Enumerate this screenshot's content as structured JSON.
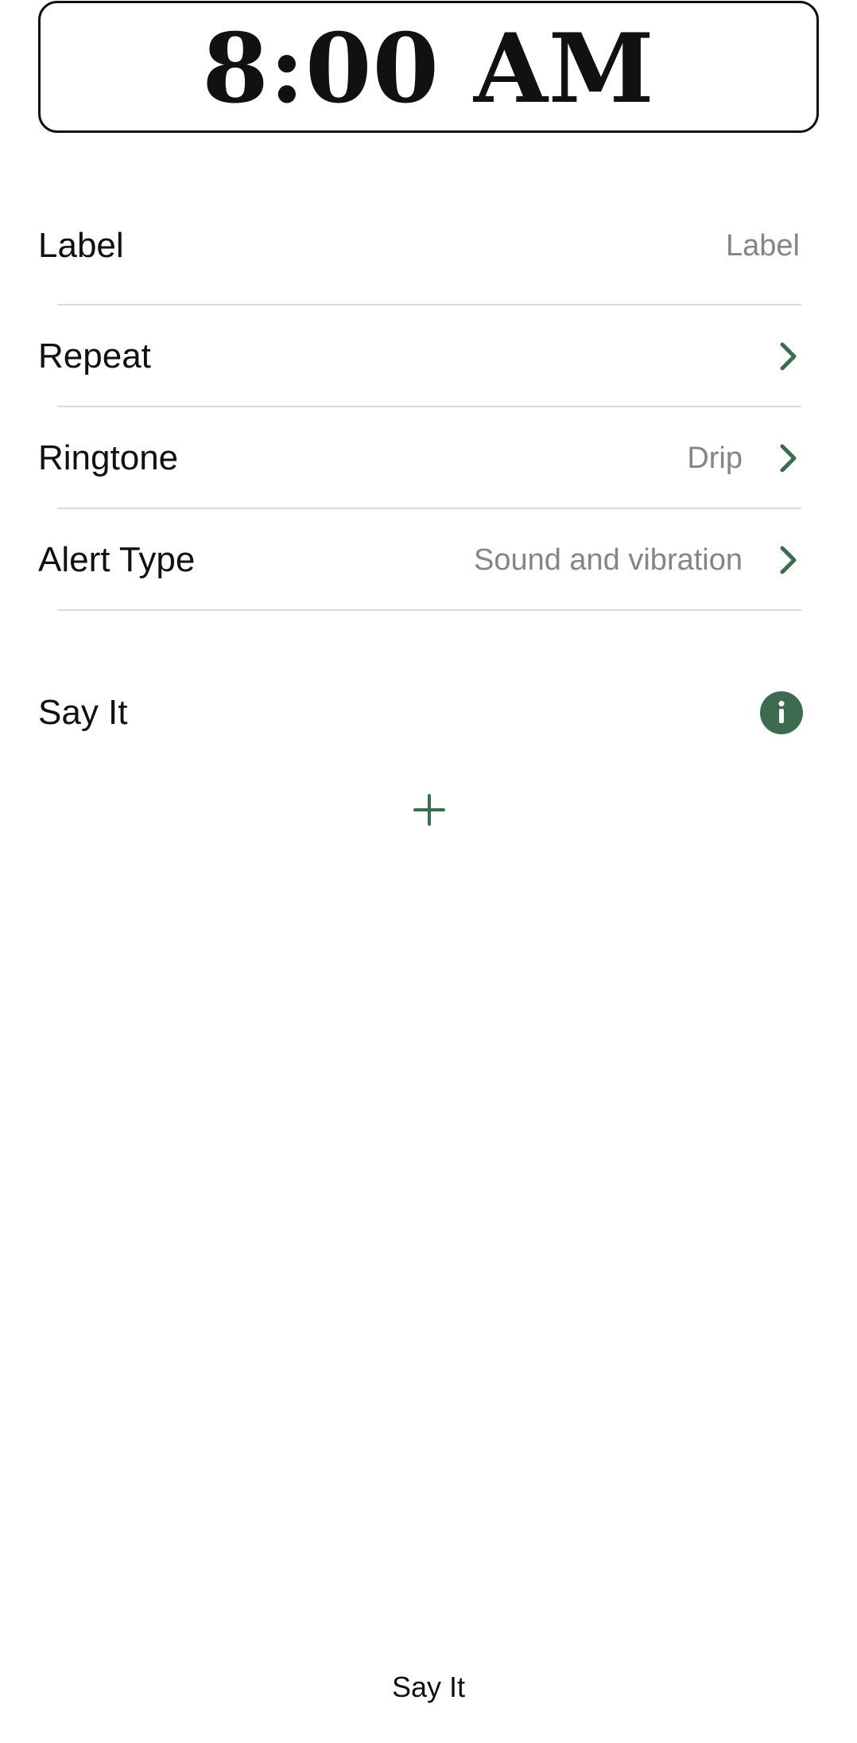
{
  "alarm": {
    "time": "8:00 AM"
  },
  "settings": {
    "label_row": {
      "title": "Label",
      "value": "Label"
    },
    "repeat_row": {
      "title": "Repeat"
    },
    "ringtone_row": {
      "title": "Ringtone",
      "value": "Drip"
    },
    "alert_type_row": {
      "title": "Alert Type",
      "value": "Sound and vibration"
    }
  },
  "say_it": {
    "title": "Say It",
    "info_icon": "info-icon",
    "add_icon": "plus-icon"
  },
  "bottom_bar": {
    "label": "Say It"
  },
  "colors": {
    "accent": "#3d6b4f",
    "secondary_text": "#858585",
    "divider": "#dcdcdc"
  }
}
